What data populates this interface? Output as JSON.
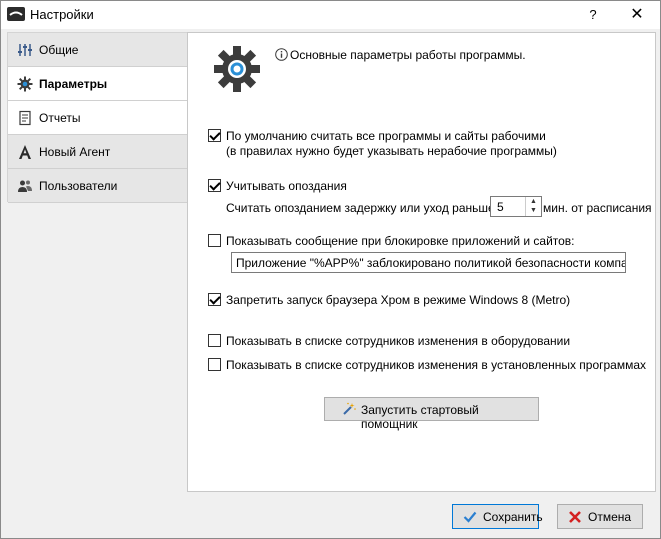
{
  "window": {
    "title": "Настройки",
    "help_label": "?",
    "close_label": "✕"
  },
  "sidebar": {
    "items": [
      {
        "label": "Общие",
        "icon": "sliders-icon",
        "active": false
      },
      {
        "label": "Параметры",
        "icon": "gear-icon",
        "active": true
      },
      {
        "label": "Отчеты",
        "icon": "report-icon",
        "active": false
      },
      {
        "label": "Новый Агент",
        "icon": "agent-icon",
        "active": false
      },
      {
        "label": "Пользователи",
        "icon": "users-icon",
        "active": false
      }
    ]
  },
  "main": {
    "info_text": "Основные параметры работы программы.",
    "opt_all_work": {
      "checked": true,
      "label": "По умолчанию считать все программы и сайты рабочими",
      "note": "(в правилах нужно будет указывать нерабочие программы)"
    },
    "opt_lateness": {
      "checked": true,
      "label": "Учитывать опоздания",
      "delay_prefix": "Считать опозданием задержку или уход раньше на",
      "delay_value": "5",
      "delay_suffix": "мин. от расписания"
    },
    "opt_block_message": {
      "checked": false,
      "label": "Показывать сообщение при блокировке приложений и сайтов:",
      "message": "Приложение \"%APP%\" заблокировано политикой безопасности компании"
    },
    "opt_block_browser": {
      "checked": true,
      "label": "Запретить запуск браузера Хром в режиме Windows 8 (Metro)"
    },
    "opt_hardware": {
      "checked": false,
      "label": "Показывать в списке сотрудников изменения в оборудовании"
    },
    "opt_software": {
      "checked": false,
      "label": "Показывать в списке сотрудников изменения в установленных программах"
    },
    "wizard_label": "Запустить стартовый помощник"
  },
  "footer": {
    "save_label": "Сохранить",
    "cancel_label": "Отмена"
  },
  "colors": {
    "accent": "#0078d7",
    "gear": "#3c3c3c",
    "gear_center": "#2a8fd6",
    "save_check": "#2b7fd0",
    "cancel_x": "#d42020"
  }
}
